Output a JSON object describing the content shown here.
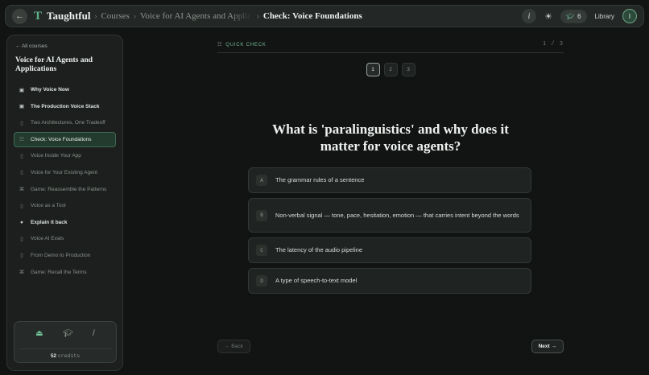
{
  "topbar": {
    "brand": "Taughtful",
    "breadcrumb": [
      "Courses",
      "Voice for AI Agents and Applications",
      "Check: Voice Foundations"
    ],
    "info_label": "i",
    "badge_count": "6",
    "library_label": "Library",
    "avatar_initial": "I",
    "icons": [
      "back-arrow-icon",
      "logo-icon",
      "info-icon",
      "sun-icon",
      "graduation-cap-icon"
    ]
  },
  "sidebar": {
    "back_label": "← All courses",
    "course_title": "Voice for AI Agents and Applications",
    "items": [
      {
        "label": "Why Voice Now",
        "icon": "film-icon",
        "state": "done"
      },
      {
        "label": "The Production Voice Stack",
        "icon": "film-icon",
        "state": "done"
      },
      {
        "label": "Two Architectures, One Tradeoff",
        "icon": "film-icon",
        "state": "pending"
      },
      {
        "label": "Check: Voice Foundations",
        "icon": "list-icon",
        "state": "active"
      },
      {
        "label": "Voice Inside Your App",
        "icon": "film-icon",
        "state": "pending"
      },
      {
        "label": "Voice for Your Existing Agent",
        "icon": "film-icon",
        "state": "pending"
      },
      {
        "label": "Game: Reassemble the Patterns",
        "icon": "gamepad-icon",
        "state": "pending"
      },
      {
        "label": "Voice as a Tool",
        "icon": "film-icon",
        "state": "pending"
      },
      {
        "label": "Explain it back",
        "icon": "microphone-icon",
        "state": "done"
      },
      {
        "label": "Voice AI Evals",
        "icon": "film-icon",
        "state": "pending"
      },
      {
        "label": "From Demo to Production",
        "icon": "film-icon",
        "state": "pending"
      },
      {
        "label": "Game: Recall the Terms",
        "icon": "gamepad-icon",
        "state": "pending"
      }
    ],
    "credits": {
      "amount": "52",
      "unit": "credits",
      "icons": [
        "bell-icon",
        "graduation-cap-icon",
        "pen-icon"
      ]
    }
  },
  "quiz": {
    "label": "QUICK CHECK",
    "counter": "1 / 3",
    "steps": [
      "1",
      "2",
      "3"
    ],
    "active_step": 0,
    "question": "What is 'paralinguistics' and why does it matter for voice agents?",
    "options": [
      {
        "key": "A",
        "text": "The grammar rules of a sentence"
      },
      {
        "key": "B",
        "text": "Non-verbal signal — tone, pace, hesitation, emotion — that carries intent beyond the words"
      },
      {
        "key": "C",
        "text": "The latency of the audio pipeline"
      },
      {
        "key": "D",
        "text": "A type of speech-to-text model"
      }
    ],
    "back_label": "← Back",
    "next_label": "Next →"
  },
  "colors": {
    "accent": "#5fb08a",
    "background": "#121413",
    "active_nav": "#233b2f"
  }
}
